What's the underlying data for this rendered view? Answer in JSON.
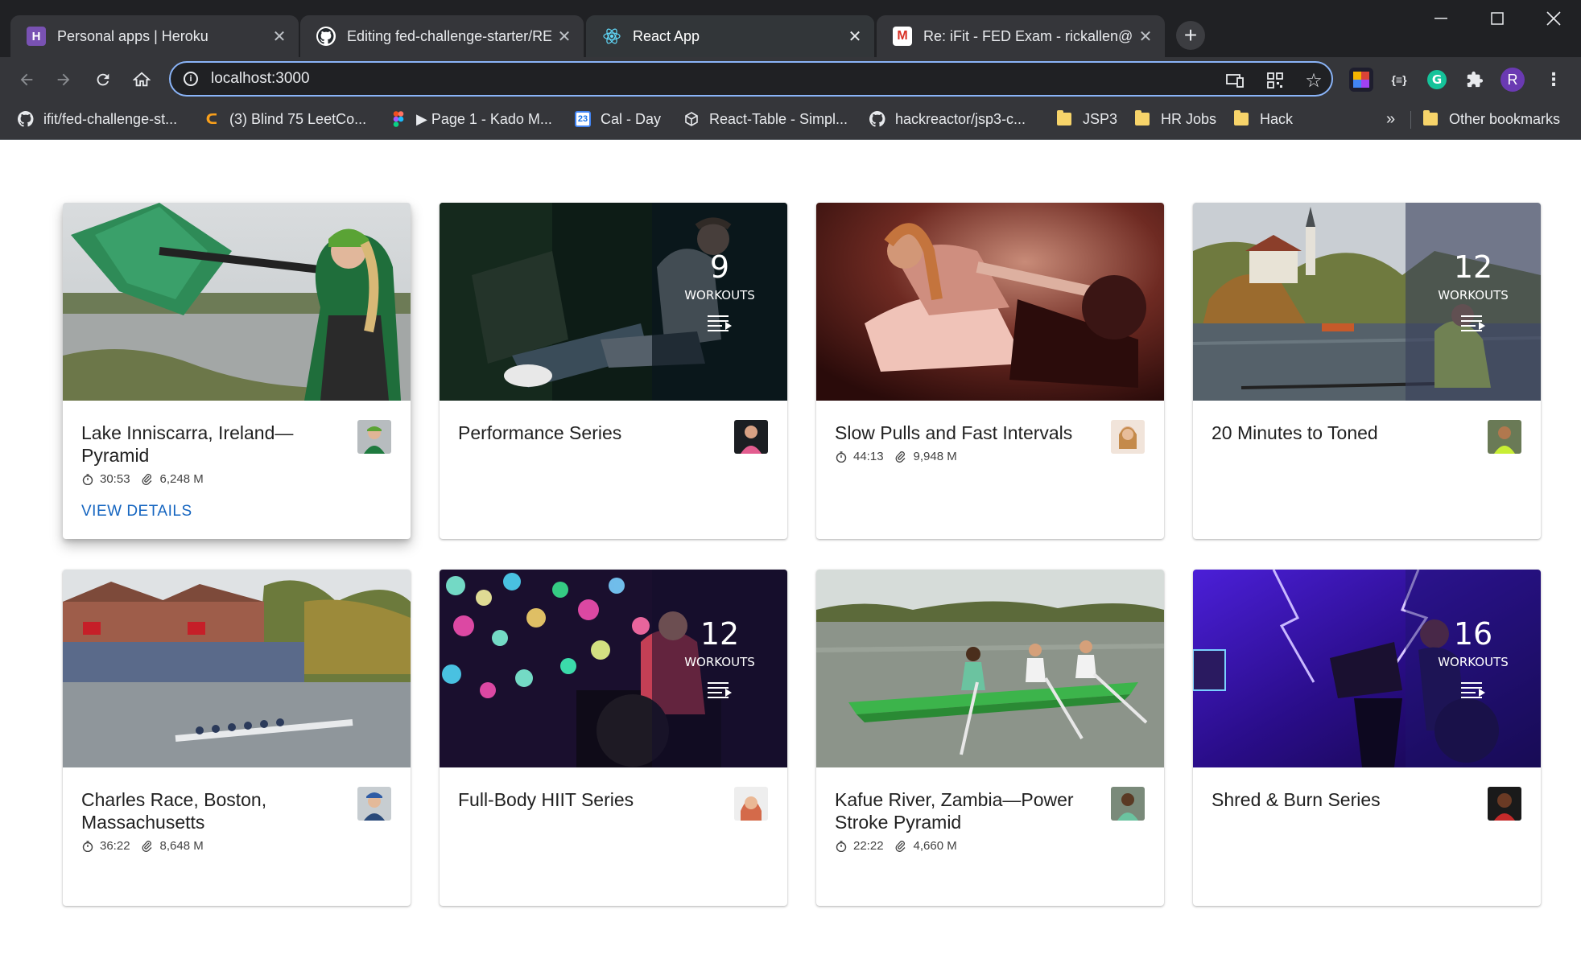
{
  "browser": {
    "tabs": [
      {
        "title": "Personal apps | Heroku",
        "icon": "heroku-icon",
        "active": false
      },
      {
        "title": "Editing fed-challenge-starter/REA",
        "icon": "github-icon",
        "active": false
      },
      {
        "title": "React App",
        "icon": "react-icon",
        "active": true
      },
      {
        "title": "Re: iFit - FED Exam - rickallen@g",
        "icon": "gmail-icon",
        "active": false
      }
    ],
    "new_tab_label": "+",
    "address": "localhost:3000",
    "profile_initial": "R",
    "bookmarks": [
      {
        "label": "ifit/fed-challenge-st...",
        "icon": "github-icon"
      },
      {
        "label": "(3) Blind 75 LeetCo...",
        "icon": "leetcode-icon"
      },
      {
        "label": "▶ Page 1 - Kado M...",
        "icon": "figma-icon"
      },
      {
        "label": "Cal - Day",
        "icon": "calendar-icon"
      },
      {
        "label": "React-Table - Simpl...",
        "icon": "codesandbox-icon"
      },
      {
        "label": "hackreactor/jsp3-c...",
        "icon": "github-icon"
      },
      {
        "label": "JSP3",
        "icon": "folder-icon"
      },
      {
        "label": "HR Jobs",
        "icon": "folder-icon"
      },
      {
        "label": "Hack",
        "icon": "folder-icon"
      }
    ],
    "bookmarks_overflow": "»",
    "other_bookmarks": "Other bookmarks"
  },
  "cards": [
    {
      "title": "Lake Inniscarra, Ireland—Pyramid",
      "time": "30:53",
      "distance": "6,248 M",
      "action": "VIEW DETAILS",
      "image": "rower-with-oar-lake"
    },
    {
      "title": "Performance Series",
      "workouts": "9",
      "workouts_label": "WORKOUTS",
      "image": "gym-rowing-machine"
    },
    {
      "title": "Slow Pulls and Fast Intervals",
      "time": "44:13",
      "distance": "9,948 M",
      "image": "woman-on-rower-red-light"
    },
    {
      "title": "20 Minutes to Toned",
      "workouts": "12",
      "workouts_label": "WORKOUTS",
      "image": "lake-bled-church"
    },
    {
      "title": "Charles Race, Boston, Massachusetts",
      "time": "36:22",
      "distance": "8,648 M",
      "image": "boathouse-crew-race"
    },
    {
      "title": "Full-Body HIIT Series",
      "workouts": "12",
      "workouts_label": "WORKOUTS",
      "image": "bokeh-lights-rower"
    },
    {
      "title": "Kafue River, Zambia—Power Stroke Pyramid",
      "time": "22:22",
      "distance": "4,660 M",
      "image": "green-canoe-river"
    },
    {
      "title": "Shred & Burn Series",
      "workouts": "16",
      "workouts_label": "WORKOUTS",
      "image": "purple-stage-rower"
    }
  ]
}
